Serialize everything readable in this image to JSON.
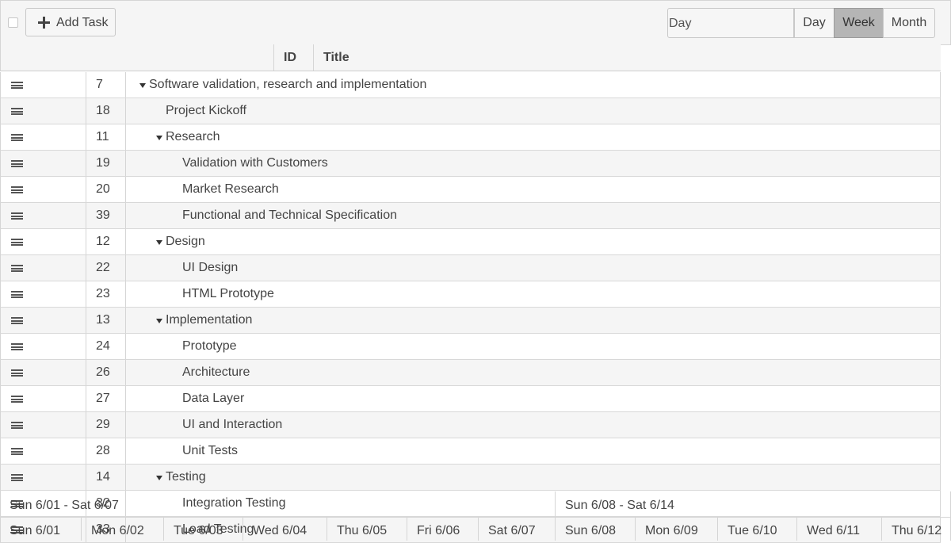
{
  "toolbar": {
    "add_task_label": "Add Task",
    "view_select_value": "Day",
    "view_buttons": [
      {
        "label": "Day",
        "active": false
      },
      {
        "label": "Week",
        "active": true
      },
      {
        "label": "Month",
        "active": false
      }
    ]
  },
  "grid": {
    "columns": {
      "id": "ID",
      "title": "Title"
    },
    "rows": [
      {
        "id": "7",
        "title": "Software validation, research and implementation",
        "level": 0,
        "expandable": true
      },
      {
        "id": "18",
        "title": "Project Kickoff",
        "level": 1,
        "expandable": false
      },
      {
        "id": "11",
        "title": "Research",
        "level": 1,
        "expandable": true
      },
      {
        "id": "19",
        "title": "Validation with Customers",
        "level": 2,
        "expandable": false
      },
      {
        "id": "20",
        "title": "Market Research",
        "level": 2,
        "expandable": false
      },
      {
        "id": "39",
        "title": "Functional and Technical Specification",
        "level": 2,
        "expandable": false
      },
      {
        "id": "12",
        "title": "Design",
        "level": 1,
        "expandable": true
      },
      {
        "id": "22",
        "title": "UI Design",
        "level": 2,
        "expandable": false
      },
      {
        "id": "23",
        "title": "HTML Prototype",
        "level": 2,
        "expandable": false
      },
      {
        "id": "13",
        "title": "Implementation",
        "level": 1,
        "expandable": true
      },
      {
        "id": "24",
        "title": "Prototype",
        "level": 2,
        "expandable": false
      },
      {
        "id": "26",
        "title": "Architecture",
        "level": 2,
        "expandable": false
      },
      {
        "id": "27",
        "title": "Data Layer",
        "level": 2,
        "expandable": false
      },
      {
        "id": "29",
        "title": "UI and Interaction",
        "level": 2,
        "expandable": false
      },
      {
        "id": "28",
        "title": "Unit Tests",
        "level": 2,
        "expandable": false
      },
      {
        "id": "14",
        "title": "Testing",
        "level": 1,
        "expandable": true
      },
      {
        "id": "32",
        "title": "Integration Testing",
        "level": 2,
        "expandable": false
      },
      {
        "id": "33",
        "title": "Load Testing",
        "level": 2,
        "expandable": false
      }
    ]
  },
  "timeline": {
    "weeks": [
      "Sun 6/01 - Sat 6/07",
      "Sun 6/08 - Sat 6/14"
    ],
    "days": [
      "Sun 6/01",
      "Mon 6/02",
      "Tue 6/03",
      "Wed 6/04",
      "Thu 6/05",
      "Fri 6/06",
      "Sat 6/07",
      "Sun 6/08",
      "Mon 6/09",
      "Tue 6/10",
      "Wed 6/11",
      "Thu 6/12"
    ]
  }
}
